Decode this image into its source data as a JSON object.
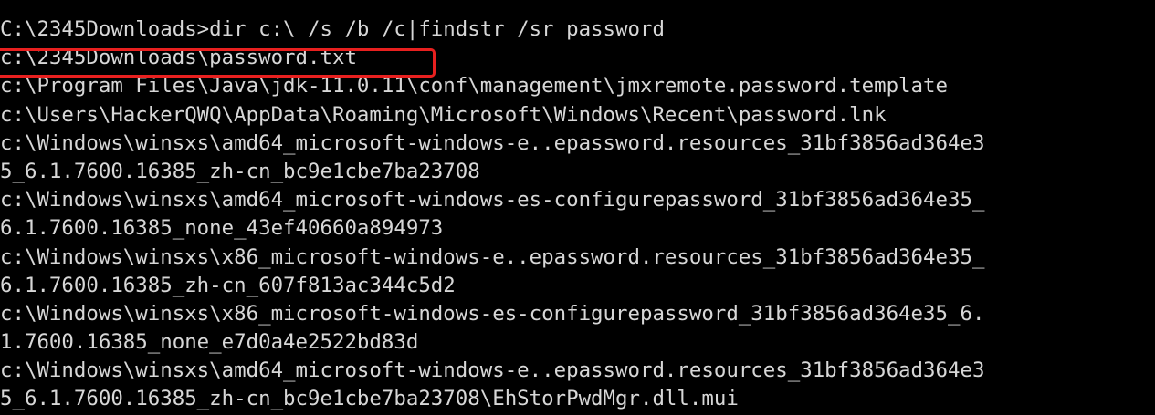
{
  "console": {
    "background": "#000000",
    "text_color": "#d7d7d7",
    "highlight_color": "#e8201f",
    "lines": [
      "C:\\2345Downloads>dir c:\\ /s /b /c|findstr /sr password",
      "c:\\2345Downloads\\password.txt",
      "c:\\Program Files\\Java\\jdk-11.0.11\\conf\\management\\jmxremote.password.template",
      "c:\\Users\\HackerQWQ\\AppData\\Roaming\\Microsoft\\Windows\\Recent\\password.lnk",
      "c:\\Windows\\winsxs\\amd64_microsoft-windows-e..epassword.resources_31bf3856ad364e3",
      "5_6.1.7600.16385_zh-cn_bc9e1cbe7ba23708",
      "c:\\Windows\\winsxs\\amd64_microsoft-windows-es-configurepassword_31bf3856ad364e35_",
      "6.1.7600.16385_none_43ef40660a894973",
      "c:\\Windows\\winsxs\\x86_microsoft-windows-e..epassword.resources_31bf3856ad364e35_",
      "6.1.7600.16385_zh-cn_607f813ac344c5d2",
      "c:\\Windows\\winsxs\\x86_microsoft-windows-es-configurepassword_31bf3856ad364e35_6.",
      "1.7600.16385_none_e7d0a4e2522bd83d",
      "c:\\Windows\\winsxs\\amd64_microsoft-windows-e..epassword.resources_31bf3856ad364e3",
      "5_6.1.7600.16385_zh-cn_bc9e1cbe7ba23708\\EhStorPwdMgr.dll.mui"
    ]
  }
}
